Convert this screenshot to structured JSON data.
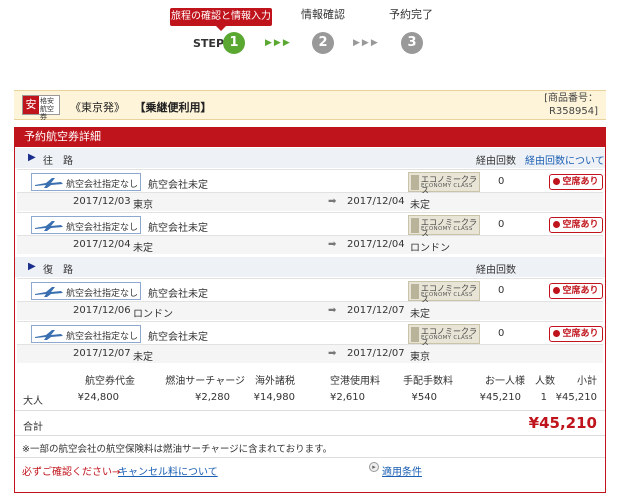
{
  "steps": {
    "step_word": "STEP",
    "items": [
      {
        "label": "旅程の確認と情報入力",
        "num": "1",
        "color": "#5aa832"
      },
      {
        "label": "情報確認",
        "num": "2",
        "color": "#999999"
      },
      {
        "label": "予約完了",
        "num": "3",
        "color": "#999999"
      }
    ],
    "arrows_active": "▶▶▶",
    "arrows_inactive": "▶▶▶",
    "active_arrow_color": "#5aa832",
    "inactive_arrow_color": "#999999"
  },
  "product": {
    "badge_char": "安",
    "badge_line1": "格安",
    "badge_line2": "航空券",
    "origin": "《東京発》",
    "type": "【乗継便利用】",
    "number_label": "[商品番号：",
    "number_value": "R358954]"
  },
  "panel": {
    "title": "予約航空券詳細",
    "outbound": {
      "title": "往　路",
      "stops_label": "経由回数",
      "link": "経由回数について"
    },
    "return": {
      "title": "復　路",
      "stops_label": "経由回数"
    },
    "flights": [
      {
        "airline": "航空会社指定なし",
        "carrier": "航空会社未定",
        "class_jp": "エコノミークラス",
        "class_en": "ECONOMY CLASS",
        "stops": "0",
        "seat": "空席あり",
        "dep_date": "2017/12/03",
        "dep_city": "東京",
        "arr_date": "2017/12/04",
        "arr_city": "未定"
      },
      {
        "airline": "航空会社指定なし",
        "carrier": "航空会社未定",
        "class_jp": "エコノミークラス",
        "class_en": "ECONOMY CLASS",
        "stops": "0",
        "seat": "空席あり",
        "dep_date": "2017/12/04",
        "dep_city": "未定",
        "arr_date": "2017/12/04",
        "arr_city": "ロンドン"
      },
      {
        "airline": "航空会社指定なし",
        "carrier": "航空会社未定",
        "class_jp": "エコノミークラス",
        "class_en": "ECONOMY CLASS",
        "stops": "0",
        "seat": "空席あり",
        "dep_date": "2017/12/06",
        "dep_city": "ロンドン",
        "arr_date": "2017/12/07",
        "arr_city": "未定"
      },
      {
        "airline": "航空会社指定なし",
        "carrier": "航空会社未定",
        "class_jp": "エコノミークラス",
        "class_en": "ECONOMY CLASS",
        "stops": "0",
        "seat": "空席あり",
        "dep_date": "2017/12/07",
        "dep_city": "未定",
        "arr_date": "2017/12/07",
        "arr_city": "東京"
      }
    ]
  },
  "price": {
    "headers": [
      "航空券代金",
      "燃油サーチャージ",
      "海外諸税",
      "空港使用料",
      "手配手数料",
      "お一人様",
      "人数",
      "小計"
    ],
    "row_label": "大人",
    "row": [
      "¥24,800",
      "¥2,280",
      "¥14,980",
      "¥2,610",
      "¥540",
      "¥45,210",
      "1",
      "¥45,210"
    ],
    "total_label": "合計",
    "total_value": "¥45,210"
  },
  "notes": {
    "insurance": "※一部の航空会社の航空保険料は燃油サーチャージに含まれております。",
    "confirm": "必ずご確認ください→",
    "cancel_link": "キャンセル料について",
    "conditions_link": "適用条件"
  },
  "colors": {
    "brand_red": "#c0141c",
    "link_blue": "#1a5fb4",
    "header_cream": "#fdf4d9"
  }
}
